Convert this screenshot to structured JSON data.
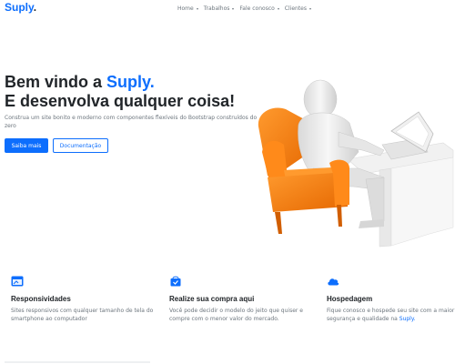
{
  "navbar": {
    "brand": "Suply",
    "brand_dot": ".",
    "items": [
      {
        "label": "Home"
      },
      {
        "label": "Trabalhos"
      },
      {
        "label": "Fale conosco"
      },
      {
        "label": "Clientes"
      }
    ]
  },
  "hero": {
    "title_prefix": "Bem vindo a ",
    "title_accent": "Suply.",
    "title_line2": "E desenvolva qualquer coisa!",
    "lead": "Construa um site bonito e moderno com componentes flexíveis do Bootstrap construídos do zero",
    "primary_button": "Saiba mais",
    "secondary_button": "Documentação"
  },
  "features": [
    {
      "title": "Responsividades",
      "text": "Sites responsivos com qualquer tamanho de tela do smartphone ao computador"
    },
    {
      "title": "Realize sua compra aqui",
      "text": "Você pode decidir o modelo do jeito que quiser e compre com o menor valor do mercado."
    },
    {
      "title": "Hospedagem",
      "text": "Fique conosco e hospede seu site com a maior segurança e qualidade na ",
      "link": "Suply."
    }
  ],
  "colors": {
    "accent": "#0d6efd",
    "chair": "#ff7a00",
    "muted": "#6c757d"
  }
}
